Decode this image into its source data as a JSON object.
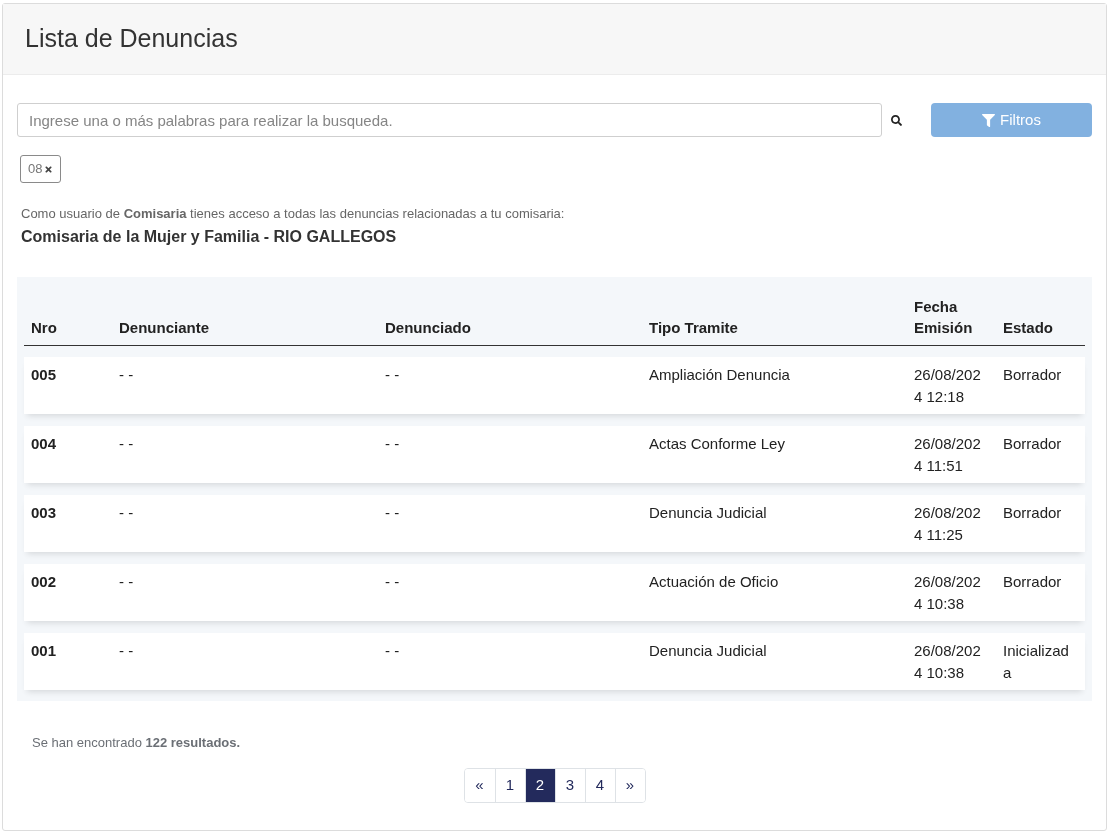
{
  "page": {
    "title": "Lista de Denuncias"
  },
  "search": {
    "placeholder": "Ingrese una o más palabras para realizar la busqueda.",
    "filter_button": "Filtros"
  },
  "active_filters": [
    {
      "label": "08"
    }
  ],
  "access_note": "Como usuario de **Comisaria** tienes acceso a todas las denuncias relacionadas a tu comisaria:",
  "station": "Comisaria de la Mujer y Familia - RIO GALLEGOS",
  "table": {
    "columns": [
      "Nro",
      "Denunciante",
      "Denunciado",
      "Tipo Tramite",
      "Fecha Emisión",
      "Estado"
    ],
    "rows": [
      {
        "cells": [
          "005",
          "- -",
          "- -",
          "Ampliación Denuncia",
          "26/08/2024 12:18",
          "Borrador"
        ]
      },
      {
        "cells": [
          "004",
          "- -",
          "- -",
          "Actas Conforme Ley",
          "26/08/2024 11:51",
          "Borrador"
        ]
      },
      {
        "cells": [
          "003",
          "- -",
          "- -",
          "Denuncia Judicial",
          "26/08/2024 11:25",
          "Borrador"
        ]
      },
      {
        "cells": [
          "002",
          "- -",
          "- -",
          "Actuación de Oficio",
          "26/08/2024 10:38",
          "Borrador"
        ]
      },
      {
        "cells": [
          "001",
          "- -",
          "- -",
          "Denuncia Judicial",
          "26/08/2024 10:38",
          "Inicializada"
        ]
      }
    ]
  },
  "results_summary": "Se han encontrado **122 resultados.**",
  "pagination": [
    {
      "label": "«",
      "selected": false
    },
    {
      "label": "1",
      "selected": false
    },
    {
      "label": "2",
      "selected": true
    },
    {
      "label": "3",
      "selected": false
    },
    {
      "label": "4",
      "selected": false
    },
    {
      "label": "»",
      "selected": false
    }
  ]
}
